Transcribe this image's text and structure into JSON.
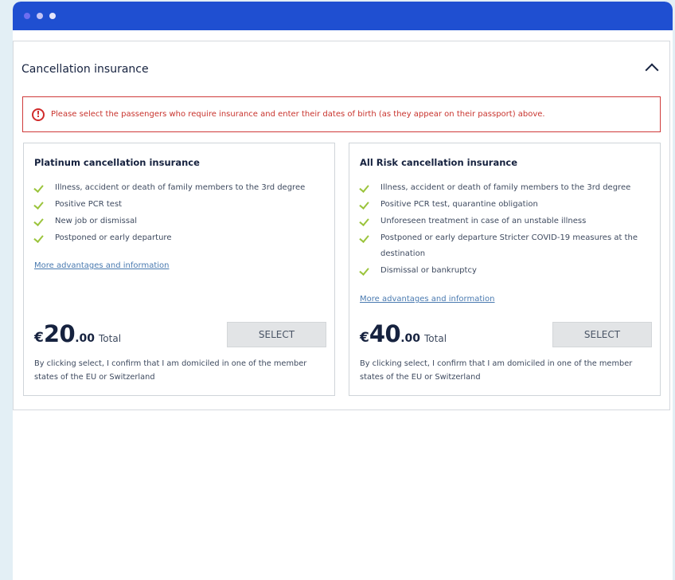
{
  "section": {
    "title": "Cancellation insurance",
    "alert": "Please select the passengers who require insurance and enter their dates of birth (as they appear on their passport) above."
  },
  "cards": [
    {
      "title": "Platinum cancellation insurance",
      "features": [
        "Illness, accident or death of family members to the 3rd degree",
        "Positive PCR test",
        "New job or dismissal",
        "Postponed or early departure"
      ],
      "more_link": "More advantages and information",
      "currency": "€",
      "price_whole": "20",
      "price_cents": ".00",
      "total_label": "Total",
      "select_label": "SELECT",
      "disclaimer": "By clicking select, I confirm that I am domiciled in one of the member states of the EU or Switzerland"
    },
    {
      "title": "All Risk cancellation insurance",
      "features": [
        "Illness, accident or death of family members to the 3rd degree",
        "Positive PCR test, quarantine obligation",
        "Unforeseen treatment in case of an unstable illness",
        "Postponed or early departure Stricter COVID-19 measures at the destination",
        "Dismissal or bankruptcy"
      ],
      "more_link": "More advantages and information",
      "currency": "€",
      "price_whole": "40",
      "price_cents": ".00",
      "total_label": "Total",
      "select_label": "SELECT",
      "disclaimer": "By clicking select, I confirm that I am domiciled in one of the member states of the EU or Switzerland"
    }
  ],
  "icons": {
    "feature": "check-icon",
    "alert": "exclamation-circle-icon",
    "collapse": "chevron-up-icon"
  },
  "colors": {
    "titlebar": "#1f4fd1",
    "alert": "#cf3a3a",
    "check": "#9bc43c",
    "link": "#4a7ab0"
  }
}
